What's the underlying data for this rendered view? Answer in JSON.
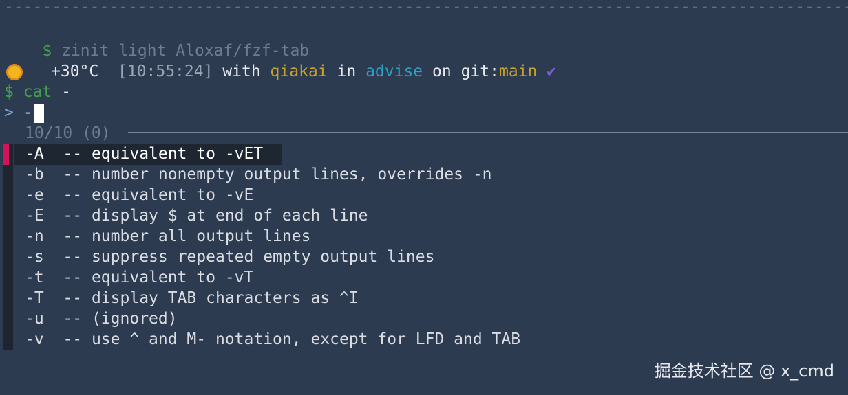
{
  "terminal": {
    "separator": "--------------------------------------------------------------------------------------------------------------",
    "history_prompt": "$",
    "history_command": "zinit light Aloxaf/fzf-tab",
    "status": {
      "temperature": "+30°C",
      "time": "[10:55:24]",
      "with_word": "with",
      "user": "qiakai",
      "in_word": "in",
      "directory": "advise",
      "on_word": "on",
      "git_label": "git:",
      "branch": "main",
      "check_glyph": "✔"
    },
    "prompt_symbol": "$",
    "command_name": "cat",
    "command_arg": "-",
    "fzf": {
      "query_prompt": ">",
      "query": "-",
      "counter": "10/10 (0)",
      "options": [
        {
          "flag": "-A",
          "description": "equivalent to -vET"
        },
        {
          "flag": "-b",
          "description": "number nonempty output lines, overrides -n"
        },
        {
          "flag": "-e",
          "description": "equivalent to -vE"
        },
        {
          "flag": "-E",
          "description": "display $ at end of each line"
        },
        {
          "flag": "-n",
          "description": "number all output lines"
        },
        {
          "flag": "-s",
          "description": "suppress repeated empty output lines"
        },
        {
          "flag": "-t",
          "description": "equivalent to -vT"
        },
        {
          "flag": "-T",
          "description": "display TAB characters as ^I"
        },
        {
          "flag": "-u",
          "description": "(ignored)"
        },
        {
          "flag": "-v",
          "description": "use ^ and M- notation, except for LFD and TAB"
        }
      ]
    }
  },
  "watermark": "掘金技术社区 @ x_cmd",
  "colors": {
    "background": "#2c3b50",
    "prompt_green": "#3fa24a",
    "user_yellow": "#c9a227",
    "dir_cyan": "#2e9ec1",
    "check_purple": "#7d5bd1",
    "selection_marker": "#d2145a"
  },
  "icons": {
    "weather": "sun-icon",
    "git_status": "checkmark-icon"
  }
}
